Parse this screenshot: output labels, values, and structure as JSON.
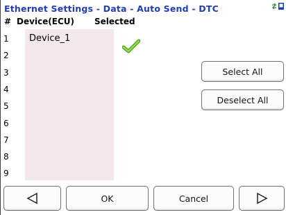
{
  "header": {
    "title": "Ethernet Settings - Data - Auto Send - DTC",
    "status_icon": "network-status-icon"
  },
  "table": {
    "columns": [
      "#",
      "Device(ECU)",
      "Selected"
    ],
    "rows": [
      {
        "num": "1",
        "device": "Device_1",
        "selected": true
      },
      {
        "num": "2",
        "device": "",
        "selected": false
      },
      {
        "num": "3",
        "device": "",
        "selected": false
      },
      {
        "num": "4",
        "device": "",
        "selected": false
      },
      {
        "num": "5",
        "device": "",
        "selected": false
      },
      {
        "num": "6",
        "device": "",
        "selected": false
      },
      {
        "num": "7",
        "device": "",
        "selected": false
      },
      {
        "num": "8",
        "device": "",
        "selected": false
      },
      {
        "num": "9",
        "device": "",
        "selected": false
      }
    ]
  },
  "actions": {
    "select_all": "Select All",
    "deselect_all": "Deselect All"
  },
  "footer": {
    "prev_icon": "triangle-left-icon",
    "ok": "OK",
    "cancel": "Cancel",
    "next_icon": "triangle-right-icon"
  },
  "colors": {
    "title": "#1f3fb0",
    "list_background": "#f4e8ef",
    "check": "#6fbf2a"
  }
}
